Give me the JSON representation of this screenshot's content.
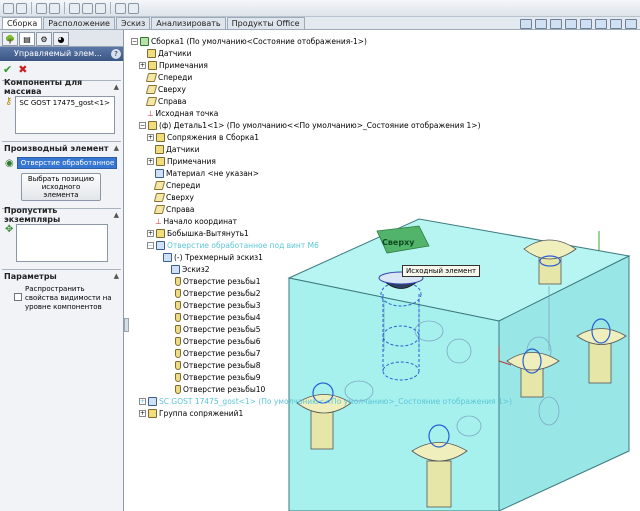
{
  "toolbar": {
    "icon_names": [
      "new-icon",
      "open-icon",
      "save-icon",
      "print-icon",
      "undo-icon",
      "select-icon",
      "rebuild-icon",
      "file-props-icon",
      "options-icon"
    ]
  },
  "tabs": [
    "Сборка",
    "Расположение",
    "Эскиз",
    "Анализировать",
    "Продукты Office"
  ],
  "active_tab": "Сборка",
  "panel": {
    "title": "Управляемый элем...",
    "help": "?",
    "ok": "✔",
    "cancel": "✖",
    "components": {
      "header": "Компоненты для массива",
      "value": "SC GOST 17475_gost<1>"
    },
    "driving": {
      "header": "Производный элемент",
      "value": "Отверстие обработанное",
      "button": "Выбрать позицию исходного элемента"
    },
    "skip": {
      "header": "Пропустить экземпляры"
    },
    "params": {
      "header": "Параметры",
      "option": "Распространить свойства видимости на уровне компонентов"
    }
  },
  "tree": [
    {
      "label": "Сборка1  (По умолчанию<Состояние отображения-1>)",
      "icon": "assembly-icon"
    },
    {
      "label": "Датчики",
      "icon": "sensors-icon"
    },
    {
      "label": "Примечания",
      "icon": "annotations-icon"
    },
    {
      "label": "Спереди",
      "icon": "plane-icon"
    },
    {
      "label": "Сверху",
      "icon": "plane-icon"
    },
    {
      "label": "Справа",
      "icon": "plane-icon"
    },
    {
      "label": "Исходная точка",
      "icon": "origin-icon"
    },
    {
      "label": "(ф) Деталь1<1> (По умолчанию<<По умолчанию>_Состояние отображения 1>)",
      "icon": "part-icon"
    },
    {
      "label": "Сопряжения в Сборка1",
      "icon": "mates-icon"
    },
    {
      "label": "Датчики",
      "icon": "sensors-icon"
    },
    {
      "label": "Примечания",
      "icon": "annotations-icon"
    },
    {
      "label": "Материал <не указан>",
      "icon": "material-icon"
    },
    {
      "label": "Спереди",
      "icon": "plane-icon"
    },
    {
      "label": "Сверху",
      "icon": "plane-icon"
    },
    {
      "label": "Справа",
      "icon": "plane-icon"
    },
    {
      "label": "Начало координат",
      "icon": "origin-icon"
    },
    {
      "label": "Бобышка-Вытянуть1",
      "icon": "extrude-icon"
    },
    {
      "label": "Отверстие обработанное под винт М6",
      "icon": "hole-wizard-icon"
    },
    {
      "label": "(-) Трехмерный эскиз1",
      "icon": "sketch3d-icon"
    },
    {
      "label": "Эскиз2",
      "icon": "sketch-icon"
    },
    {
      "label": "Отверстие резьбы1",
      "icon": "hole-icon"
    },
    {
      "label": "Отверстие резьбы2",
      "icon": "hole-icon"
    },
    {
      "label": "Отверстие резьбы3",
      "icon": "hole-icon"
    },
    {
      "label": "Отверстие резьбы4",
      "icon": "hole-icon"
    },
    {
      "label": "Отверстие резьбы5",
      "icon": "hole-icon"
    },
    {
      "label": "Отверстие резьбы6",
      "icon": "hole-icon"
    },
    {
      "label": "Отверстие резьбы7",
      "icon": "hole-icon"
    },
    {
      "label": "Отверстие резьбы8",
      "icon": "hole-icon"
    },
    {
      "label": "Отверстие резьбы9",
      "icon": "hole-icon"
    },
    {
      "label": "Отверстие резьбы10",
      "icon": "hole-icon"
    },
    {
      "label": "SC GOST 17475_gost<1> (По умолчанию<<По умолчанию>_Состояние отображения 1>)",
      "icon": "component-icon"
    },
    {
      "label": "Группа сопряжений1",
      "icon": "mate-group-icon"
    }
  ],
  "scene": {
    "tooltip": "Исходный элемент",
    "face_label": "Сверху"
  },
  "colors": {
    "part": "#a8f0f0",
    "screw": "#e8e8b0",
    "highlight": "#2aa6d6",
    "triad": "#2e9a2e"
  }
}
